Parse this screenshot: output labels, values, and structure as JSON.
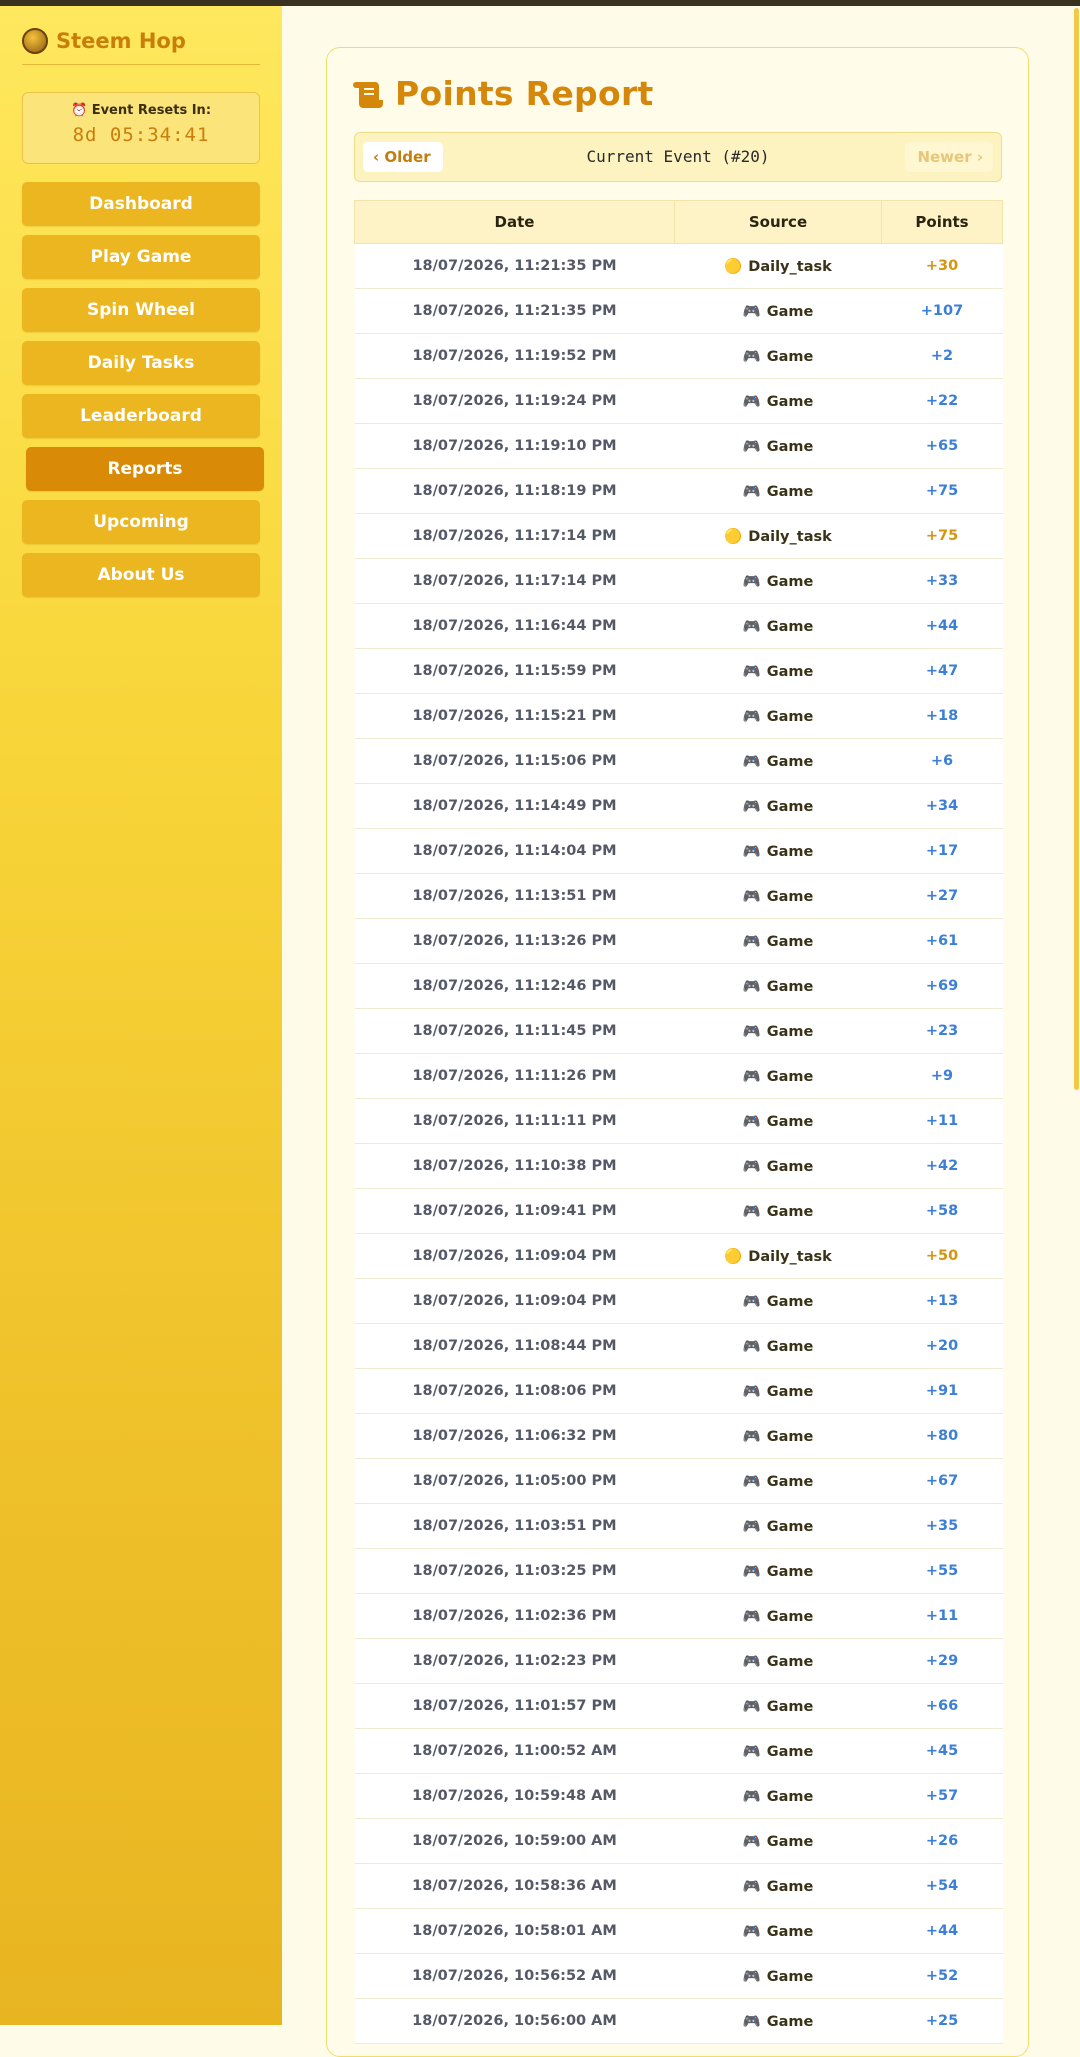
{
  "brand": {
    "name": "Steem Hop"
  },
  "timer": {
    "label": "⏰ Event Resets In:",
    "value": "8d 05:34:41"
  },
  "nav": [
    {
      "label": "Dashboard",
      "active": false
    },
    {
      "label": "Play Game",
      "active": false
    },
    {
      "label": "Spin Wheel",
      "active": false
    },
    {
      "label": "Daily Tasks",
      "active": false
    },
    {
      "label": "Leaderboard",
      "active": false
    },
    {
      "label": "Reports",
      "active": true
    },
    {
      "label": "Upcoming",
      "active": false
    },
    {
      "label": "About Us",
      "active": false
    }
  ],
  "report": {
    "title": "Points Report",
    "older_label": "Older",
    "newer_label": "Newer",
    "event_label": "Current Event (#20)",
    "columns": [
      "Date",
      "Source",
      "Points"
    ],
    "rows": [
      {
        "date": "18/07/2026, 11:21:35 PM",
        "source": "Daily_task",
        "icon": "🟡",
        "points": "+30"
      },
      {
        "date": "18/07/2026, 11:21:35 PM",
        "source": "Game",
        "icon": "🎮",
        "points": "+107"
      },
      {
        "date": "18/07/2026, 11:19:52 PM",
        "source": "Game",
        "icon": "🎮",
        "points": "+2"
      },
      {
        "date": "18/07/2026, 11:19:24 PM",
        "source": "Game",
        "icon": "🎮",
        "points": "+22"
      },
      {
        "date": "18/07/2026, 11:19:10 PM",
        "source": "Game",
        "icon": "🎮",
        "points": "+65"
      },
      {
        "date": "18/07/2026, 11:18:19 PM",
        "source": "Game",
        "icon": "🎮",
        "points": "+75"
      },
      {
        "date": "18/07/2026, 11:17:14 PM",
        "source": "Daily_task",
        "icon": "🟡",
        "points": "+75"
      },
      {
        "date": "18/07/2026, 11:17:14 PM",
        "source": "Game",
        "icon": "🎮",
        "points": "+33"
      },
      {
        "date": "18/07/2026, 11:16:44 PM",
        "source": "Game",
        "icon": "🎮",
        "points": "+44"
      },
      {
        "date": "18/07/2026, 11:15:59 PM",
        "source": "Game",
        "icon": "🎮",
        "points": "+47"
      },
      {
        "date": "18/07/2026, 11:15:21 PM",
        "source": "Game",
        "icon": "🎮",
        "points": "+18"
      },
      {
        "date": "18/07/2026, 11:15:06 PM",
        "source": "Game",
        "icon": "🎮",
        "points": "+6"
      },
      {
        "date": "18/07/2026, 11:14:49 PM",
        "source": "Game",
        "icon": "🎮",
        "points": "+34"
      },
      {
        "date": "18/07/2026, 11:14:04 PM",
        "source": "Game",
        "icon": "🎮",
        "points": "+17"
      },
      {
        "date": "18/07/2026, 11:13:51 PM",
        "source": "Game",
        "icon": "🎮",
        "points": "+27"
      },
      {
        "date": "18/07/2026, 11:13:26 PM",
        "source": "Game",
        "icon": "🎮",
        "points": "+61"
      },
      {
        "date": "18/07/2026, 11:12:46 PM",
        "source": "Game",
        "icon": "🎮",
        "points": "+69"
      },
      {
        "date": "18/07/2026, 11:11:45 PM",
        "source": "Game",
        "icon": "🎮",
        "points": "+23"
      },
      {
        "date": "18/07/2026, 11:11:26 PM",
        "source": "Game",
        "icon": "🎮",
        "points": "+9"
      },
      {
        "date": "18/07/2026, 11:11:11 PM",
        "source": "Game",
        "icon": "🎮",
        "points": "+11"
      },
      {
        "date": "18/07/2026, 11:10:38 PM",
        "source": "Game",
        "icon": "🎮",
        "points": "+42"
      },
      {
        "date": "18/07/2026, 11:09:41 PM",
        "source": "Game",
        "icon": "🎮",
        "points": "+58"
      },
      {
        "date": "18/07/2026, 11:09:04 PM",
        "source": "Daily_task",
        "icon": "🟡",
        "points": "+50"
      },
      {
        "date": "18/07/2026, 11:09:04 PM",
        "source": "Game",
        "icon": "🎮",
        "points": "+13"
      },
      {
        "date": "18/07/2026, 11:08:44 PM",
        "source": "Game",
        "icon": "🎮",
        "points": "+20"
      },
      {
        "date": "18/07/2026, 11:08:06 PM",
        "source": "Game",
        "icon": "🎮",
        "points": "+91"
      },
      {
        "date": "18/07/2026, 11:06:32 PM",
        "source": "Game",
        "icon": "🎮",
        "points": "+80"
      },
      {
        "date": "18/07/2026, 11:05:00 PM",
        "source": "Game",
        "icon": "🎮",
        "points": "+67"
      },
      {
        "date": "18/07/2026, 11:03:51 PM",
        "source": "Game",
        "icon": "🎮",
        "points": "+35"
      },
      {
        "date": "18/07/2026, 11:03:25 PM",
        "source": "Game",
        "icon": "🎮",
        "points": "+55"
      },
      {
        "date": "18/07/2026, 11:02:36 PM",
        "source": "Game",
        "icon": "🎮",
        "points": "+11"
      },
      {
        "date": "18/07/2026, 11:02:23 PM",
        "source": "Game",
        "icon": "🎮",
        "points": "+29"
      },
      {
        "date": "18/07/2026, 11:01:57 PM",
        "source": "Game",
        "icon": "🎮",
        "points": "+66"
      },
      {
        "date": "18/07/2026, 11:00:52 AM",
        "source": "Game",
        "icon": "🎮",
        "points": "+45"
      },
      {
        "date": "18/07/2026, 10:59:48 AM",
        "source": "Game",
        "icon": "🎮",
        "points": "+57"
      },
      {
        "date": "18/07/2026, 10:59:00 AM",
        "source": "Game",
        "icon": "🎮",
        "points": "+26"
      },
      {
        "date": "18/07/2026, 10:58:36 AM",
        "source": "Game",
        "icon": "🎮",
        "points": "+54"
      },
      {
        "date": "18/07/2026, 10:58:01 AM",
        "source": "Game",
        "icon": "🎮",
        "points": "+44"
      },
      {
        "date": "18/07/2026, 10:56:52 AM",
        "source": "Game",
        "icon": "🎮",
        "points": "+52"
      },
      {
        "date": "18/07/2026, 10:56:00 AM",
        "source": "Game",
        "icon": "🎮",
        "points": "+25"
      }
    ]
  },
  "colors": {
    "accent": "#d4870a",
    "active_nav": "#d98a07",
    "nav": "#ebb61f",
    "game_points": "#3c7fd6",
    "task_points": "#d7940f"
  }
}
